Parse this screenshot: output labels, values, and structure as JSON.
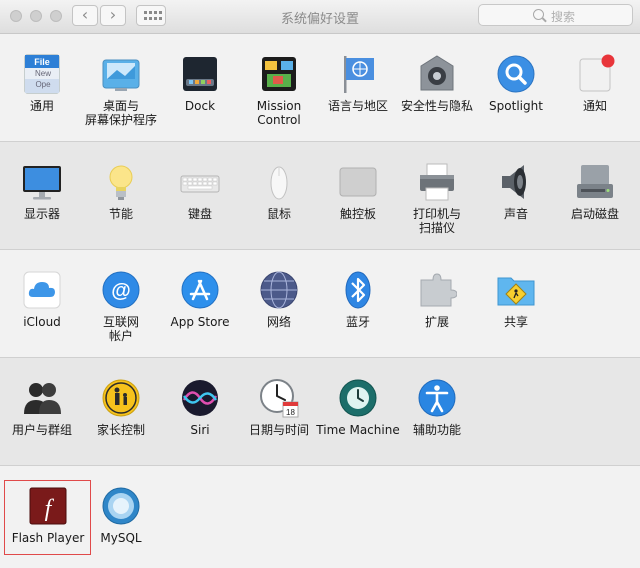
{
  "window": {
    "title": "系统偏好设置",
    "search_placeholder": "搜索",
    "back_glyph": "‹",
    "forward_glyph": "›"
  },
  "rows": [
    [
      {
        "label": "通用",
        "icon": "general-icon"
      },
      {
        "label": "桌面与\n屏幕保护程序",
        "icon": "desktop-screensaver-icon"
      },
      {
        "label": "Dock",
        "icon": "dock-icon"
      },
      {
        "label": "Mission\nControl",
        "icon": "mission-control-icon"
      },
      {
        "label": "语言与地区",
        "icon": "language-region-icon"
      },
      {
        "label": "安全性与隐私",
        "icon": "security-privacy-icon"
      },
      {
        "label": "Spotlight",
        "icon": "spotlight-icon"
      },
      {
        "label": "通知",
        "icon": "notifications-icon"
      }
    ],
    [
      {
        "label": "显示器",
        "icon": "displays-icon"
      },
      {
        "label": "节能",
        "icon": "energy-saver-icon"
      },
      {
        "label": "键盘",
        "icon": "keyboard-icon"
      },
      {
        "label": "鼠标",
        "icon": "mouse-icon"
      },
      {
        "label": "触控板",
        "icon": "trackpad-icon"
      },
      {
        "label": "打印机与\n扫描仪",
        "icon": "printers-scanners-icon"
      },
      {
        "label": "声音",
        "icon": "sound-icon"
      },
      {
        "label": "启动磁盘",
        "icon": "startup-disk-icon"
      }
    ],
    [
      {
        "label": "iCloud",
        "icon": "icloud-icon"
      },
      {
        "label": "互联网\n帐户",
        "icon": "internet-accounts-icon"
      },
      {
        "label": "App Store",
        "icon": "app-store-icon"
      },
      {
        "label": "网络",
        "icon": "network-icon"
      },
      {
        "label": "蓝牙",
        "icon": "bluetooth-icon"
      },
      {
        "label": "扩展",
        "icon": "extensions-icon"
      },
      {
        "label": "共享",
        "icon": "sharing-icon"
      }
    ],
    [
      {
        "label": "用户与群组",
        "icon": "users-groups-icon"
      },
      {
        "label": "家长控制",
        "icon": "parental-controls-icon"
      },
      {
        "label": "Siri",
        "icon": "siri-icon"
      },
      {
        "label": "日期与时间",
        "icon": "date-time-icon"
      },
      {
        "label": "Time Machine",
        "icon": "time-machine-icon"
      },
      {
        "label": "辅助功能",
        "icon": "accessibility-icon"
      }
    ],
    [
      {
        "label": "Flash Player",
        "icon": "flash-player-icon"
      },
      {
        "label": "MySQL",
        "icon": "mysql-icon"
      }
    ]
  ],
  "icon_texts": {
    "general_file": "File",
    "general_new": "New",
    "general_ope": "Ope",
    "flash_glyph": "f",
    "at_glyph": "@",
    "date_badge": "18"
  },
  "colors": {
    "highlight_border": "#e04a4a",
    "notification_dot": "#e8353a"
  }
}
